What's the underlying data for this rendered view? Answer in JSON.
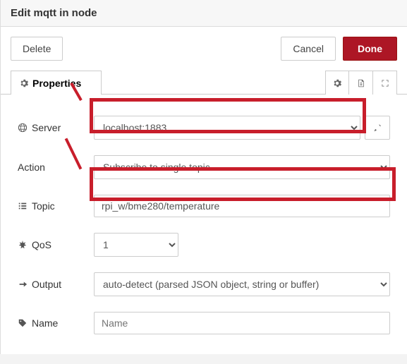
{
  "header": {
    "title": "Edit mqtt in node"
  },
  "buttons": {
    "delete": "Delete",
    "cancel": "Cancel",
    "done": "Done"
  },
  "tabs": {
    "properties": "Properties"
  },
  "form": {
    "server": {
      "label": "Server",
      "value": "localhost:1883"
    },
    "action": {
      "label": "Action",
      "value": "Subscribe to single topic"
    },
    "topic": {
      "label": "Topic",
      "value": "rpi_w/bme280/temperature"
    },
    "qos": {
      "label": "QoS",
      "value": "1"
    },
    "output": {
      "label": "Output",
      "value": "auto-detect (parsed JSON object, string or buffer)"
    },
    "name": {
      "label": "Name",
      "placeholder": "Name",
      "value": ""
    }
  }
}
